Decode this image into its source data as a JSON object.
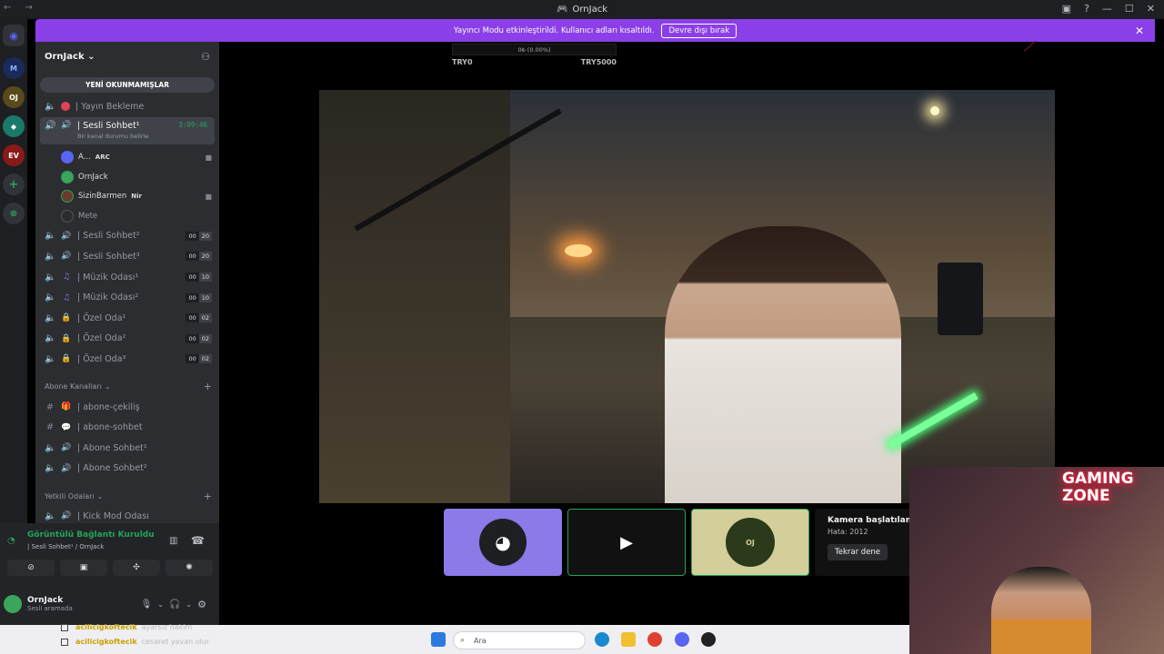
{
  "window": {
    "title": "OrnJack"
  },
  "banner": {
    "text": "Yayıncı Modu etkinleştirildi. Kullanıcı adları kısaltıldı.",
    "button": "Devre dışı bırak"
  },
  "server": {
    "name": "OrnJack"
  },
  "unread_button": "YENİ OKUNMAMIŞLAR",
  "channels_top": [
    {
      "name": "| Yayın Bekleme",
      "count_a": "",
      "count_b": ""
    }
  ],
  "active_channel": {
    "name": "| Sesli Sohbet¹",
    "timer": "3:09:46",
    "status": "Bir kanal durumu belirle"
  },
  "voice_users": [
    {
      "name": "A...",
      "tag": "ARC",
      "color": "#5865f2"
    },
    {
      "name": "OrnJack",
      "tag": "",
      "color": "#3ba55c"
    },
    {
      "name": "SizinBarmen",
      "tag": "Nir",
      "color": "#23a55a"
    },
    {
      "name": "Mete",
      "tag": "",
      "color": "#2b2d31"
    }
  ],
  "channels": [
    {
      "name": "| Sesli Sohbet²",
      "a": "00",
      "b": "20"
    },
    {
      "name": "| Sesli Sohbet³",
      "a": "00",
      "b": "20"
    },
    {
      "name": "| Müzik Odası¹",
      "a": "00",
      "b": "10"
    },
    {
      "name": "| Müzik Odası²",
      "a": "00",
      "b": "10"
    },
    {
      "name": "| Özel Oda¹",
      "a": "00",
      "b": "02"
    },
    {
      "name": "| Özel Oda²",
      "a": "00",
      "b": "02"
    },
    {
      "name": "| Özel Oda³",
      "a": "00",
      "b": "02"
    }
  ],
  "categories": {
    "abone": "Abone Kanalları",
    "abone_channels": [
      "| abone-çekiliş",
      "| abone-sohbet",
      "| Abone Sohbet¹",
      "| Abone Sohbet²"
    ],
    "yetkili": "Yetkili Odaları",
    "yetkili_channels": [
      "| Kick Mod Odası"
    ]
  },
  "voice_panel": {
    "status": "Görüntülü Bağlantı Kuruldu",
    "location": "| Sesli Sohbet¹ / OrnJack"
  },
  "me": {
    "name": "OrnJack",
    "status": "Sesli aramada"
  },
  "stream_overlay": {
    "progress_text": "0₺ (0.00%)",
    "min": "TRY0",
    "max": "TRY5000"
  },
  "camera_error": {
    "title": "Kamera başlatılama",
    "code": "Hata: 2012",
    "retry": "Tekrar dene"
  },
  "webcam_sign": {
    "line1": "GAMING",
    "line2": "ZONE"
  },
  "taskbar": {
    "search_placeholder": "Ara"
  },
  "chat": [
    {
      "user": "acilicigkoftecik",
      "msg": "ayarsız hakim"
    },
    {
      "user": "acilicigkoftecik",
      "msg": "cesaret yavan olur"
    }
  ],
  "colors": {
    "banner": "#8b3fe8",
    "accent": "#5865f2",
    "green": "#23a55a"
  }
}
